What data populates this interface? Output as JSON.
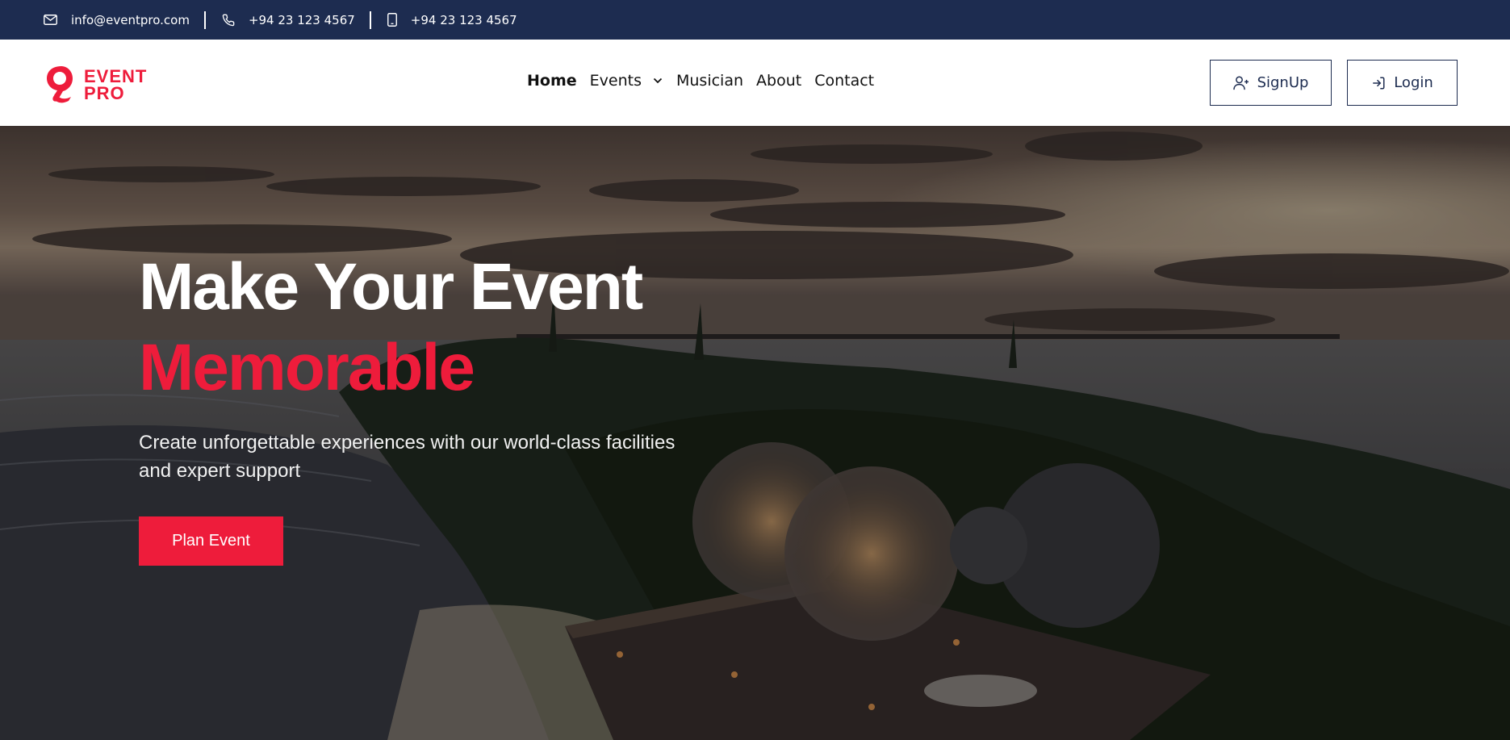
{
  "topbar": {
    "email": "info@eventpro.com",
    "phone": "+94 23 123 4567",
    "mobile": "+94 23 123 4567",
    "icons": [
      "mail-icon",
      "phone-icon",
      "mobile-icon"
    ]
  },
  "nav": {
    "logo_text": [
      "EVENT",
      "PRO"
    ],
    "links": [
      {
        "label": "Home",
        "active": true
      },
      {
        "label": "Events",
        "has_dropdown": true
      },
      {
        "label": "Musician"
      },
      {
        "label": "About"
      },
      {
        "label": "Contact"
      }
    ],
    "signup_label": "SignUp",
    "login_label": "Login"
  },
  "hero": {
    "title_line1": "Make Your Event",
    "title_line2": "Memorable",
    "subtitle": "Create unforgettable experiences with our world-class facilities and expert support",
    "cta_label": "Plan Event"
  },
  "colors": {
    "topbar_bg": "#1d2c50",
    "accent": "#ee1c3b",
    "nav_bg": "#ffffff"
  }
}
